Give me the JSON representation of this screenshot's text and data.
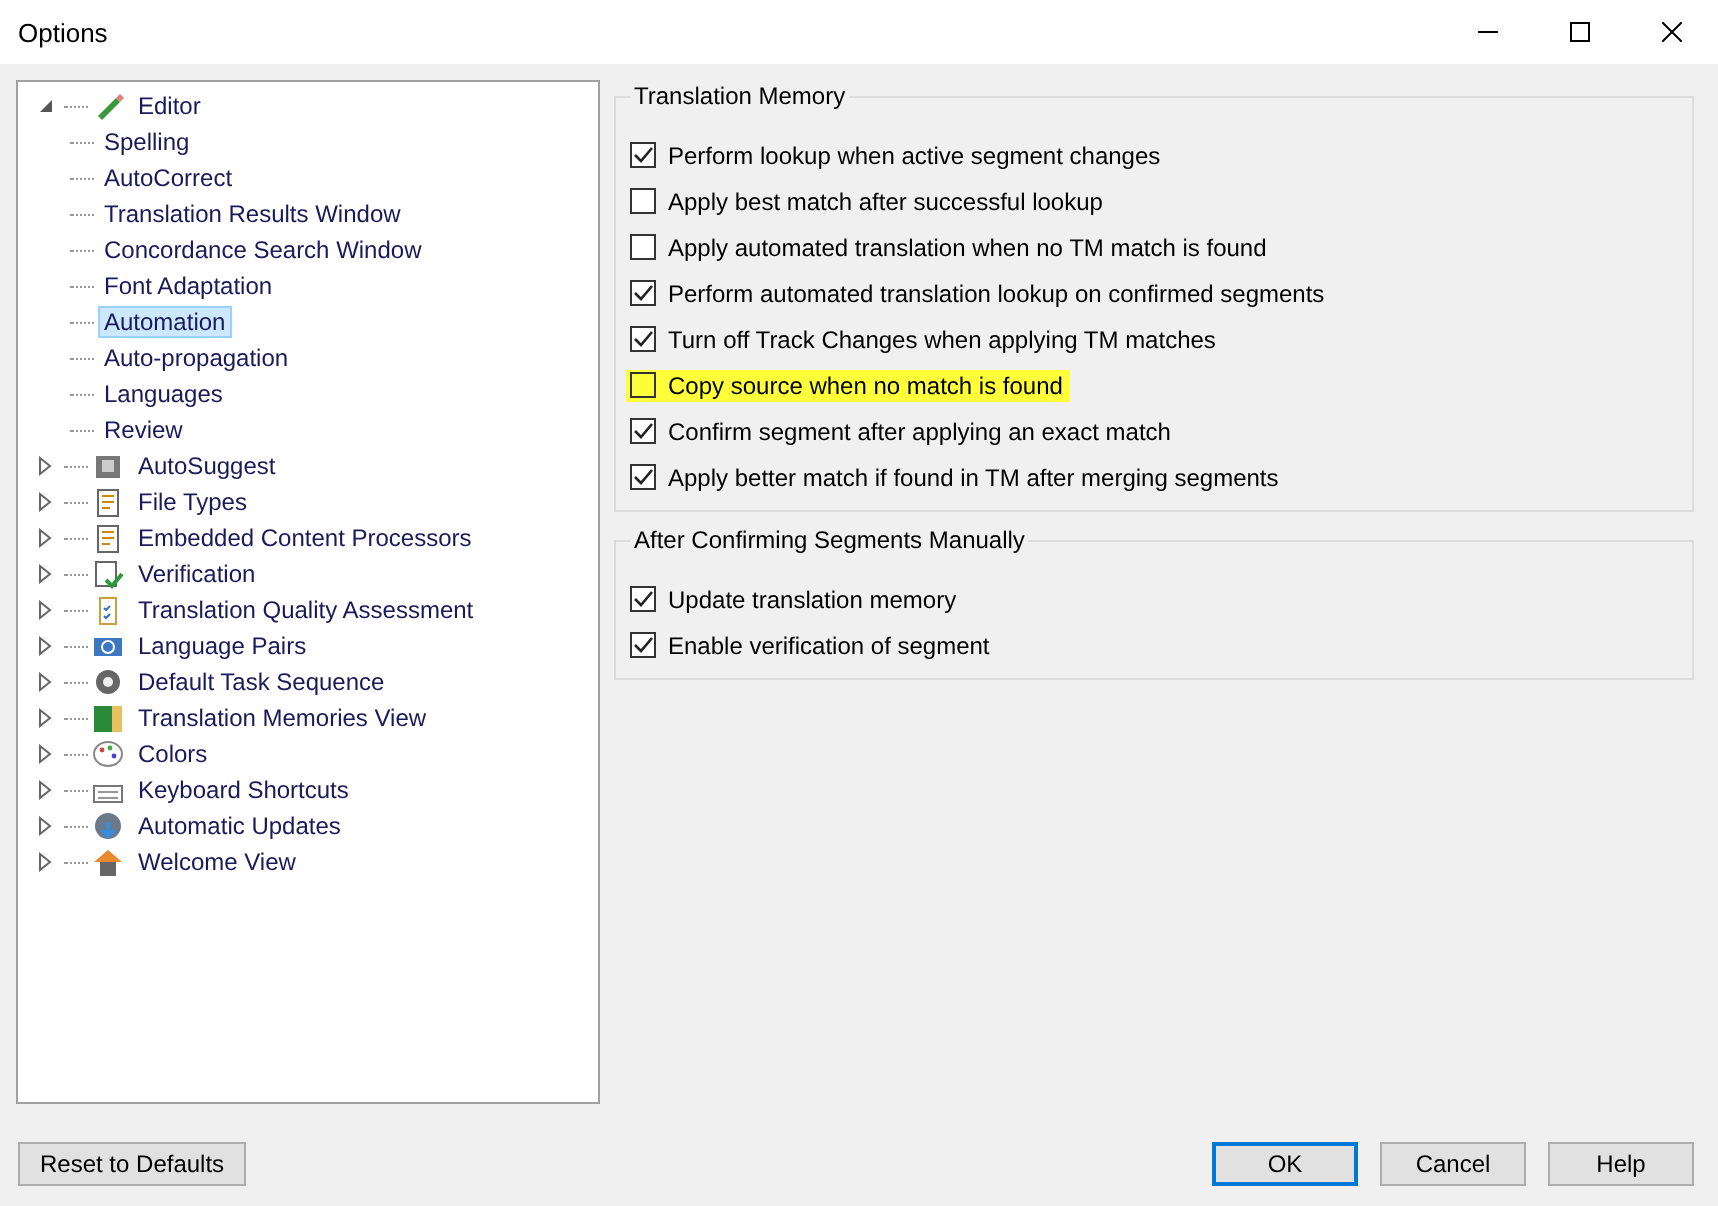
{
  "window": {
    "title": "Options"
  },
  "tree": [
    {
      "label": "Editor",
      "expanded": true,
      "selected": false,
      "children": [
        {
          "label": "Spelling",
          "selected": false
        },
        {
          "label": "AutoCorrect",
          "selected": false
        },
        {
          "label": "Translation Results Window",
          "selected": false
        },
        {
          "label": "Concordance Search Window",
          "selected": false
        },
        {
          "label": "Font Adaptation",
          "selected": false
        },
        {
          "label": "Automation",
          "selected": true
        },
        {
          "label": "Auto-propagation",
          "selected": false
        },
        {
          "label": "Languages",
          "selected": false
        },
        {
          "label": "Review",
          "selected": false
        }
      ]
    },
    {
      "label": "AutoSuggest",
      "expanded": false,
      "selected": false
    },
    {
      "label": "File Types",
      "expanded": false,
      "selected": false
    },
    {
      "label": "Embedded Content Processors",
      "expanded": false,
      "selected": false
    },
    {
      "label": "Verification",
      "expanded": false,
      "selected": false
    },
    {
      "label": "Translation Quality Assessment",
      "expanded": false,
      "selected": false
    },
    {
      "label": "Language Pairs",
      "expanded": false,
      "selected": false
    },
    {
      "label": "Default Task Sequence",
      "expanded": false,
      "selected": false
    },
    {
      "label": "Translation Memories View",
      "expanded": false,
      "selected": false
    },
    {
      "label": "Colors",
      "expanded": false,
      "selected": false
    },
    {
      "label": "Keyboard Shortcuts",
      "expanded": false,
      "selected": false
    },
    {
      "label": "Automatic Updates",
      "expanded": false,
      "selected": false
    },
    {
      "label": "Welcome View",
      "expanded": false,
      "selected": false
    }
  ],
  "groups": [
    {
      "title": "Translation Memory",
      "options": [
        {
          "label": "Perform lookup when active segment changes",
          "checked": true,
          "highlighted": false
        },
        {
          "label": "Apply best match after successful lookup",
          "checked": false,
          "highlighted": false
        },
        {
          "label": "Apply automated translation when no TM match is found",
          "checked": false,
          "highlighted": false
        },
        {
          "label": "Perform automated translation lookup on confirmed segments",
          "checked": true,
          "highlighted": false
        },
        {
          "label": "Turn off Track Changes when applying TM matches",
          "checked": true,
          "highlighted": false
        },
        {
          "label": "Copy source when no match is found",
          "checked": false,
          "highlighted": true
        },
        {
          "label": "Confirm segment after applying an exact match",
          "checked": true,
          "highlighted": false
        },
        {
          "label": "Apply better match if found in TM after merging segments",
          "checked": true,
          "highlighted": false
        }
      ]
    },
    {
      "title": "After Confirming Segments Manually",
      "options": [
        {
          "label": "Update translation memory",
          "checked": true,
          "highlighted": false
        },
        {
          "label": "Enable verification of segment",
          "checked": true,
          "highlighted": false
        }
      ]
    }
  ],
  "buttons": {
    "reset": "Reset to Defaults",
    "ok": "OK",
    "cancel": "Cancel",
    "help": "Help"
  }
}
